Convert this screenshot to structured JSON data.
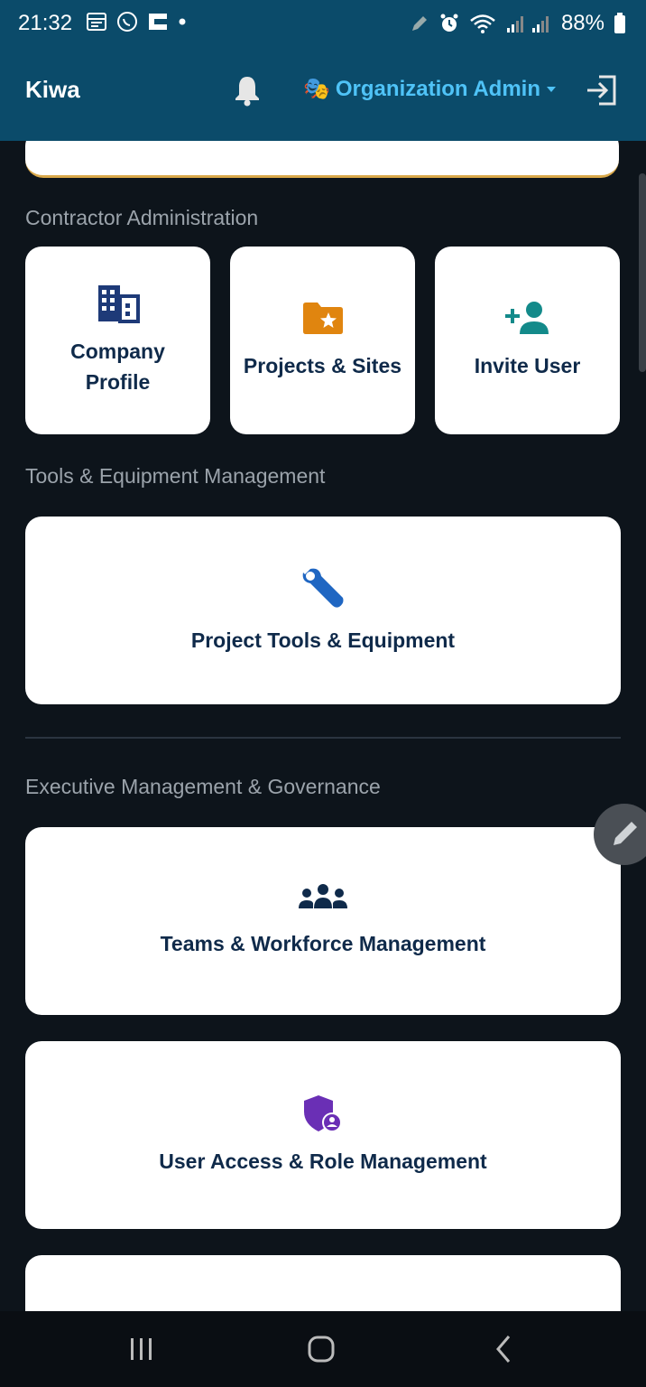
{
  "status": {
    "time": "21:32",
    "battery": "88%"
  },
  "header": {
    "title": "Kiwa",
    "role": "Organization Admin",
    "role_emoji": "🎭"
  },
  "sections": {
    "contractor": {
      "title": "Contractor Administration",
      "tiles": [
        {
          "line1": "Company",
          "line2": "Profile",
          "icon": "building-icon"
        },
        {
          "label": "Projects & Sites",
          "icon": "folder-star-icon"
        },
        {
          "label": "Invite User",
          "icon": "person-add-icon"
        }
      ]
    },
    "tools": {
      "title": "Tools & Equipment Management",
      "tiles": [
        {
          "label": "Project Tools & Equipment",
          "icon": "wrench-icon"
        }
      ]
    },
    "executive": {
      "title": "Executive Management & Governance",
      "tiles": [
        {
          "label": "Teams & Workforce Management",
          "icon": "groups-icon"
        },
        {
          "label": "User Access & Role Management",
          "icon": "admin-shield-icon"
        }
      ]
    }
  },
  "colors": {
    "appbar": "#0b4b6a",
    "background": "#0d141b",
    "accent": "#4fc3f7",
    "tile_text": "#0f2a4a"
  }
}
